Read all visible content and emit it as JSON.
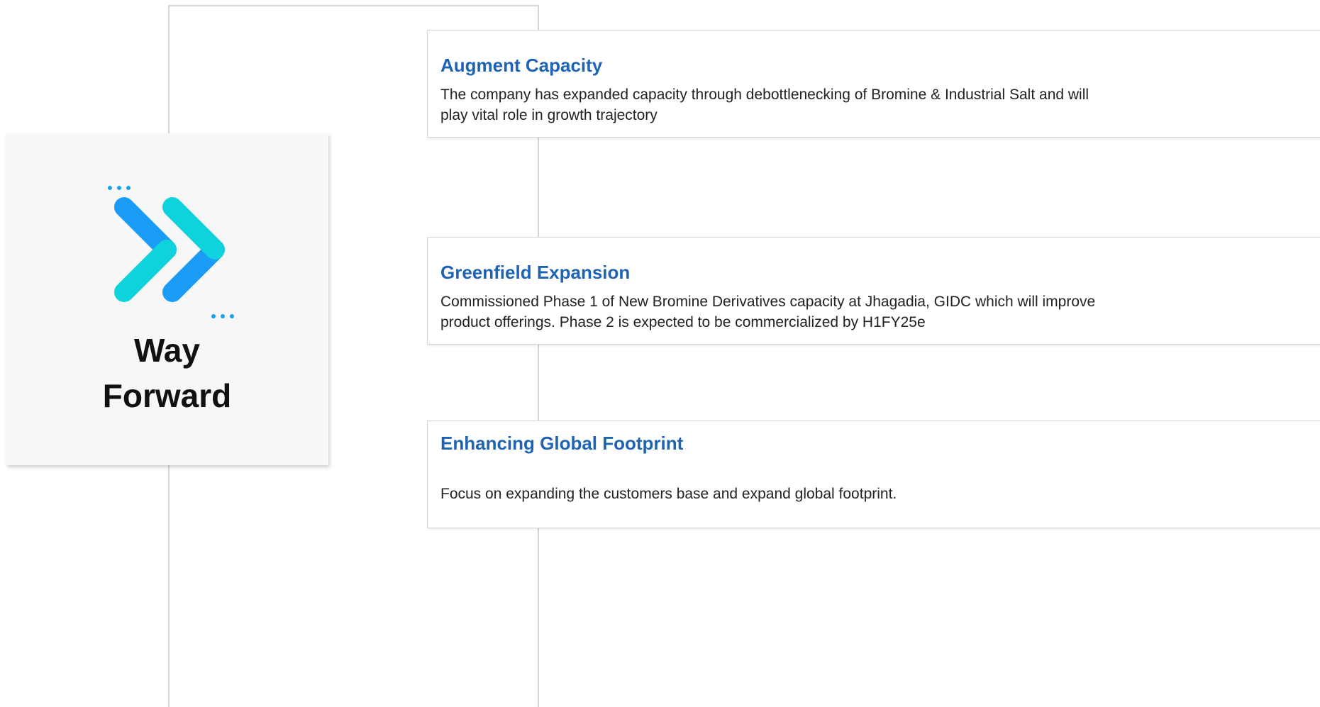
{
  "title": {
    "line1": "Way",
    "line2": "Forward"
  },
  "icon": {
    "name": "double-chevron-forward-icon",
    "colors": {
      "blue": "#1a9bf5",
      "cyan": "#0fd3dc",
      "dots": "#1aa0e8"
    }
  },
  "items": [
    {
      "heading": "Augment Capacity",
      "text": "The company has expanded capacity through debottlenecking of Bromine & Industrial Salt and will play vital role in growth trajectory"
    },
    {
      "heading": "Greenfield Expansion",
      "text": "Commissioned Phase 1 of New Bromine Derivatives capacity at  Jhagadia, GIDC which will improve product offerings. Phase 2 is expected to be commercialized by H1FY25e"
    },
    {
      "heading": "Enhancing Global Footprint",
      "text": "Focus on expanding the customers base and expand global footprint."
    }
  ],
  "colors": {
    "heading": "#1f64b4",
    "text": "#222222",
    "border": "#d6d6d6"
  }
}
